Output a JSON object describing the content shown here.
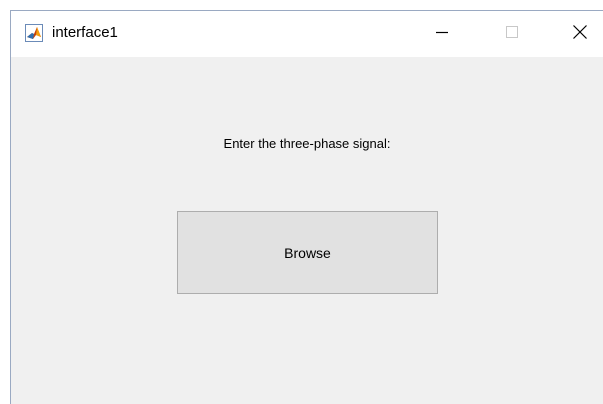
{
  "window": {
    "title": "interface1",
    "app_icon": "matlab-logo-icon",
    "controls": {
      "minimize_icon": "minimize-icon",
      "maximize_icon": "maximize-icon",
      "close_icon": "close-icon"
    }
  },
  "content": {
    "prompt_text": "Enter the three-phase signal:",
    "browse_label": "Browse"
  },
  "colors": {
    "window_background": "#f0f0f0",
    "titlebar_background": "#ffffff",
    "button_background": "#e1e1e1",
    "button_border": "#adadad",
    "window_border": "#9aa9c2"
  }
}
